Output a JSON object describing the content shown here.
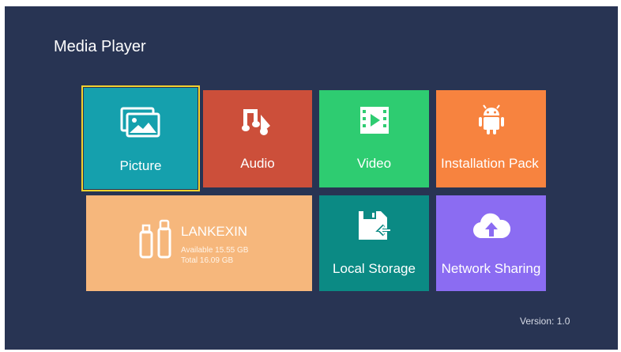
{
  "app": {
    "title": "Media Player"
  },
  "tiles": {
    "picture": {
      "label": "Picture",
      "icon": "picture-icon",
      "color": "#15a0ad",
      "focused": true
    },
    "audio": {
      "label": "Audio",
      "icon": "music-note-icon",
      "color": "#cc4f3a"
    },
    "video": {
      "label": "Video",
      "icon": "film-icon",
      "color": "#2ecc71"
    },
    "installation": {
      "label": "Installation Pack",
      "icon": "android-icon",
      "color": "#f7833f"
    },
    "usb": {
      "name": "LANKEXIN",
      "available": "Available 15.55 GB",
      "total": "Total 16.09 GB",
      "icon": "usb-drive-icon",
      "color": "#f6b77c"
    },
    "local_storage": {
      "label": "Local Storage",
      "icon": "storage-icon",
      "color": "#0b8a84"
    },
    "network_sharing": {
      "label": "Network Sharing",
      "icon": "cloud-upload-icon",
      "color": "#8b6cf2"
    }
  },
  "footer": {
    "version": "Version: 1.0"
  }
}
